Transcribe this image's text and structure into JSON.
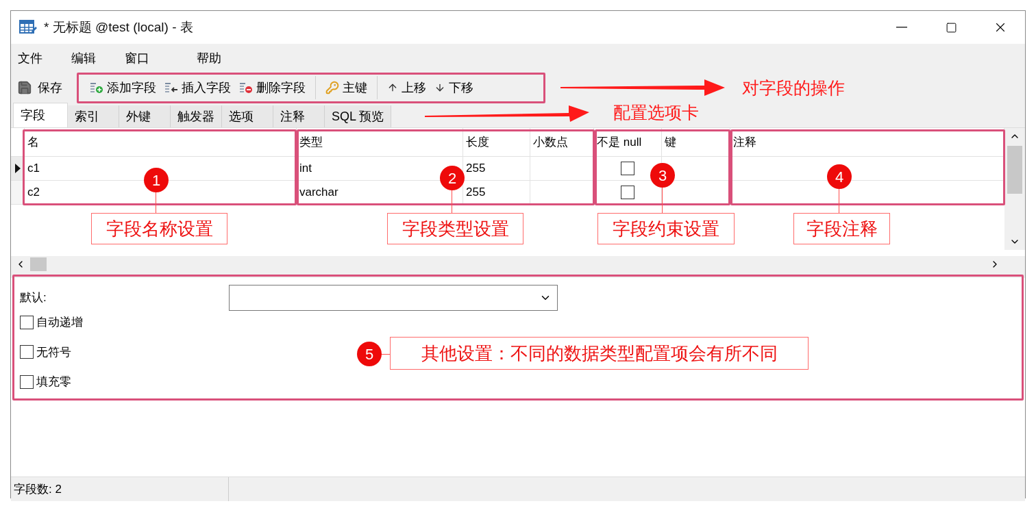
{
  "window": {
    "title": "* 无标题 @test (local) - 表"
  },
  "menu": [
    "文件",
    "编辑",
    "窗口",
    "帮助"
  ],
  "toolbar": {
    "save": "保存",
    "buttons": [
      {
        "kind": "add",
        "label": "添加字段"
      },
      {
        "kind": "insert",
        "label": "插入字段"
      },
      {
        "kind": "delete",
        "label": "删除字段"
      },
      {
        "kind": "key",
        "label": "主键"
      },
      {
        "kind": "up",
        "label": "上移"
      },
      {
        "kind": "down",
        "label": "下移"
      }
    ]
  },
  "tabs": [
    {
      "label": "字段",
      "selected": true
    },
    {
      "label": "索引",
      "selected": false
    },
    {
      "label": "外键",
      "selected": false
    },
    {
      "label": "触发器",
      "selected": false
    },
    {
      "label": "选项",
      "selected": false
    },
    {
      "label": "注释",
      "selected": false
    },
    {
      "label": "SQL 预览",
      "selected": false
    }
  ],
  "table": {
    "columns": [
      "名",
      "类型",
      "长度",
      "小数点",
      "不是 null",
      "键",
      "注释"
    ],
    "rows": [
      {
        "selected": true,
        "name": "c1",
        "type": "int",
        "length": "255",
        "not_null": false
      },
      {
        "selected": false,
        "name": "c2",
        "type": "varchar",
        "length": "255",
        "not_null": false
      }
    ]
  },
  "options": {
    "default_label": "默认:",
    "checkboxes": [
      {
        "label": "自动递增",
        "checked": false
      },
      {
        "label": "无符号",
        "checked": false
      },
      {
        "label": "填充零",
        "checked": false
      }
    ]
  },
  "status_bar": "字段数: 2",
  "annotations": {
    "arrows": [
      {
        "label": "对字段的操作"
      },
      {
        "label": "配置选项卡"
      }
    ],
    "callouts": [
      {
        "number": "1",
        "label": "字段名称设置"
      },
      {
        "number": "2",
        "label": "字段类型设置"
      },
      {
        "number": "3",
        "label": "字段约束设置"
      },
      {
        "number": "4",
        "label": "字段注释"
      },
      {
        "number": "5",
        "label": "其他设置：不同的数据类型配置项会有所不同"
      }
    ]
  }
}
